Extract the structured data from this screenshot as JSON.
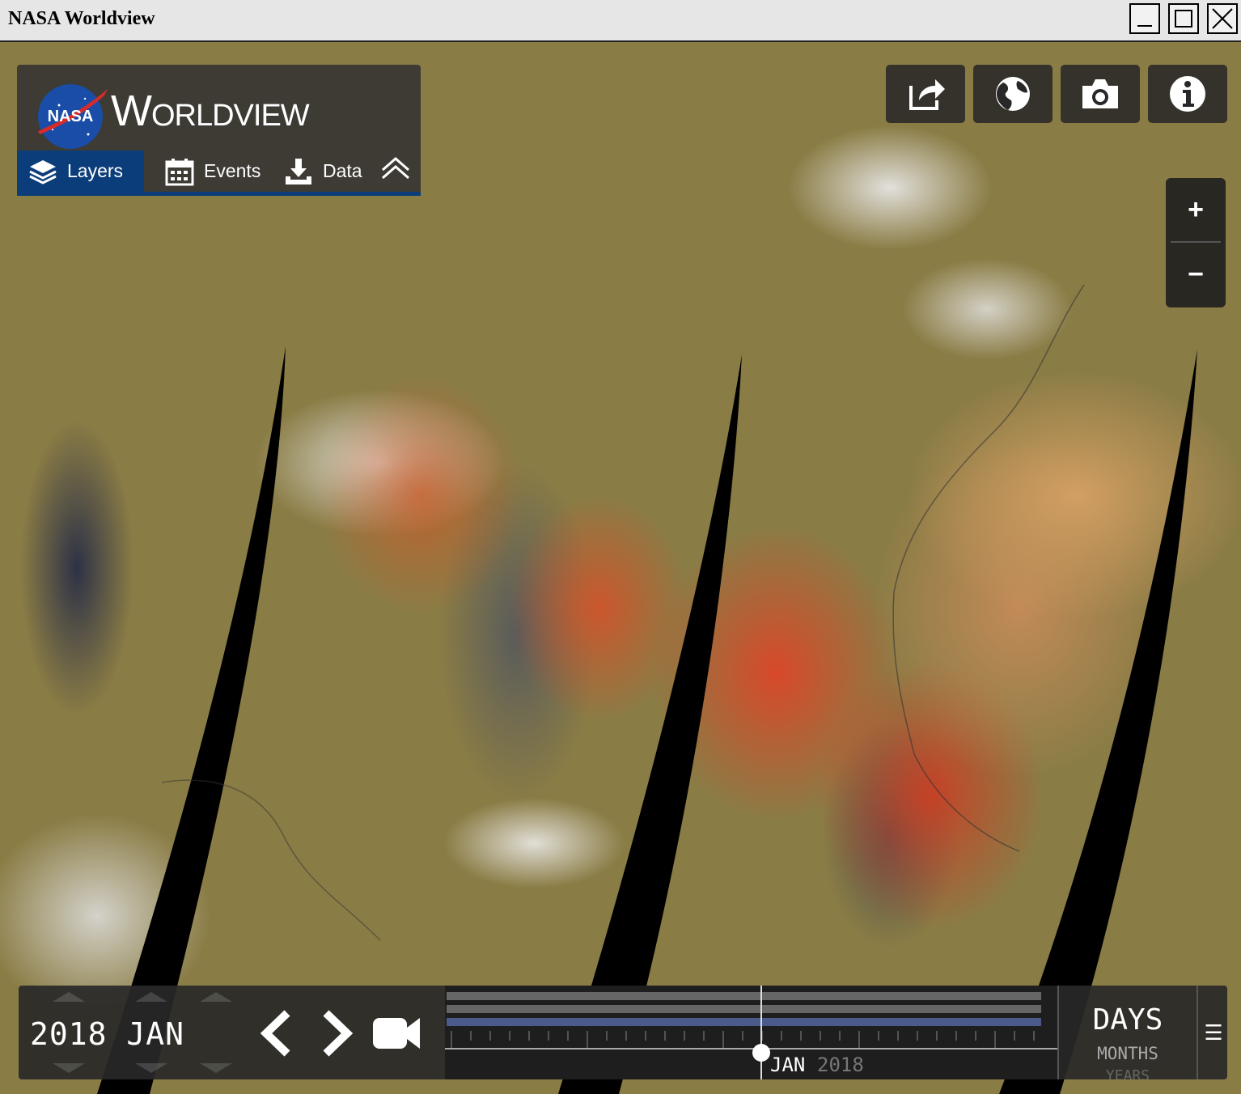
{
  "window": {
    "title": "NASA Worldview"
  },
  "header": {
    "app_name": "Worldview",
    "logo_text": "NASA"
  },
  "tabs": [
    {
      "label": "Layers",
      "active": true
    },
    {
      "label": "Events",
      "active": false
    },
    {
      "label": "Data",
      "active": false
    }
  ],
  "toolbar": [
    {
      "icon": "share-icon"
    },
    {
      "icon": "globe-icon"
    },
    {
      "icon": "camera-icon"
    },
    {
      "icon": "info-icon"
    }
  ],
  "zoom": {
    "in_label": "+",
    "out_label": "−"
  },
  "timeline": {
    "date": "2018 JAN",
    "axis_month": "JAN",
    "axis_year": "2018",
    "scale_selected": "DAYS",
    "scale_other": "MONTHS",
    "scale_third": "YEARS",
    "menu_glyph": "☰"
  },
  "colors": {
    "accent": "#0b3d7a",
    "panel": "#323232",
    "timeline_band": "#4a5a8a"
  }
}
